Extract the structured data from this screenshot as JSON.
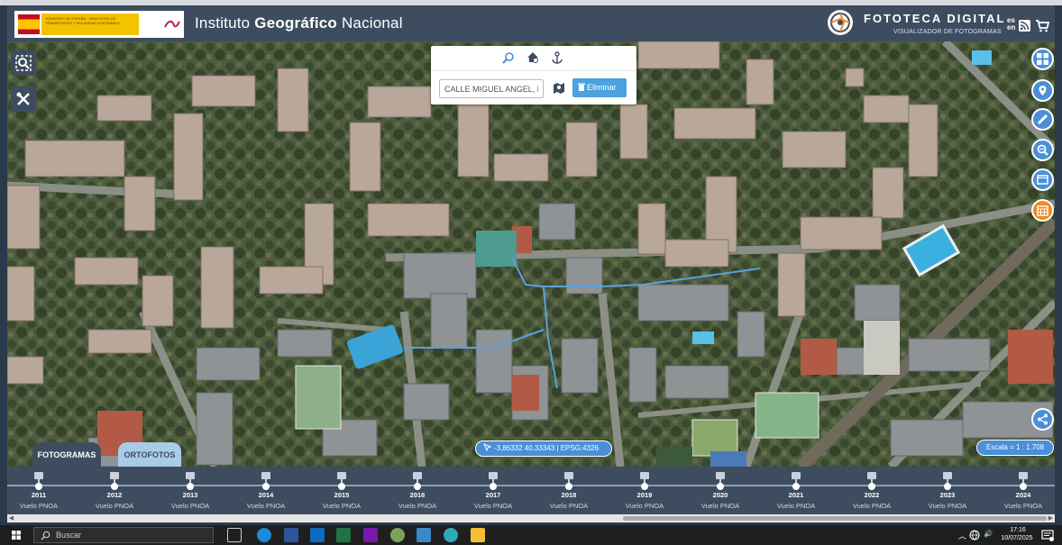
{
  "header": {
    "gov_text": "GOBIERNO DE ESPAÑA · MINISTERIO DE TRANSPORTES Y MOVILIDAD SOSTENIBLE",
    "ign_title_prefix": "Instituto ",
    "ign_title_bold": "Geográfico",
    "ign_title_suffix": " Nacional",
    "app_title": "FOTOTECA DIGITAL",
    "app_subtitle": "VISUALIZADOR DE FOTOGRAMAS",
    "lang_es": "es",
    "lang_en": "en"
  },
  "search": {
    "address_value": "CALLE MIGUEL ANGEL, M",
    "delete_label": "Eliminar"
  },
  "map": {
    "coords_text": "-3,86332  40,33343 | EPSG:4326",
    "scale_text": "Escala = 1 : 1.708"
  },
  "tabs": {
    "fotogramas": "FOTOGRAMAS",
    "ortofotos": "ORTOFOTOS"
  },
  "timeline": [
    {
      "year": "2011",
      "label": "Vuelo PNOA"
    },
    {
      "year": "2012",
      "label": "Vuelo PNOA"
    },
    {
      "year": "2013",
      "label": "Vuelo PNOA"
    },
    {
      "year": "2014",
      "label": "Vuelo PNOA"
    },
    {
      "year": "2015",
      "label": "Vuelo PNOA"
    },
    {
      "year": "2016",
      "label": "Vuelo PNOA"
    },
    {
      "year": "2017",
      "label": "Vuelo PNOA"
    },
    {
      "year": "2018",
      "label": "Vuelo PNOA"
    },
    {
      "year": "2019",
      "label": "Vuelo PNOA"
    },
    {
      "year": "2020",
      "label": "Vuelo PNOA"
    },
    {
      "year": "2021",
      "label": "Vuelo PNOA"
    },
    {
      "year": "2022",
      "label": "Vuelo PNOA"
    },
    {
      "year": "2023",
      "label": "Vuelo PNOA"
    },
    {
      "year": "2024",
      "label": "Vuelo PNOA"
    }
  ],
  "taskbar": {
    "search_text": "Buscar",
    "time": "17:16",
    "date": "10/07/2025"
  },
  "colors": {
    "panel": "#3d4d5f",
    "accent": "#4a8fd8",
    "calendar_button": "#f08a24",
    "route": "#5aa0e0"
  }
}
